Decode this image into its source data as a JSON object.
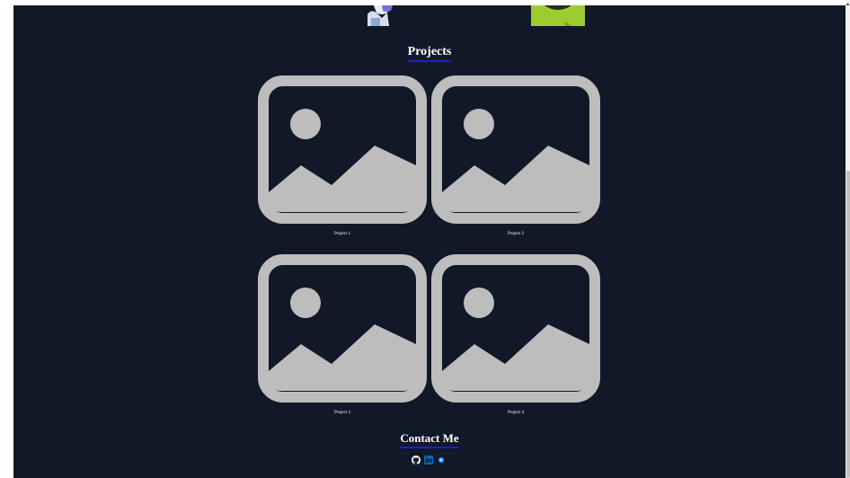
{
  "projects": {
    "title": "Projects",
    "items": [
      {
        "label": "Project 1",
        "icon": "image-placeholder-icon"
      },
      {
        "label": "Project 2",
        "icon": "image-placeholder-icon"
      },
      {
        "label": "Project 3",
        "icon": "image-placeholder-icon"
      },
      {
        "label": "Project 4",
        "icon": "image-placeholder-icon"
      }
    ]
  },
  "contact": {
    "title": "Contact Me",
    "links": [
      {
        "icon": "github-icon"
      },
      {
        "icon": "linkedin-icon"
      },
      {
        "icon": "portfolio-icon"
      }
    ]
  },
  "colors": {
    "background": "#111827",
    "accent_underline": "#1d1dd6",
    "placeholder_gray": "#bdbdbd",
    "linkedin_blue": "#0a66c2"
  }
}
